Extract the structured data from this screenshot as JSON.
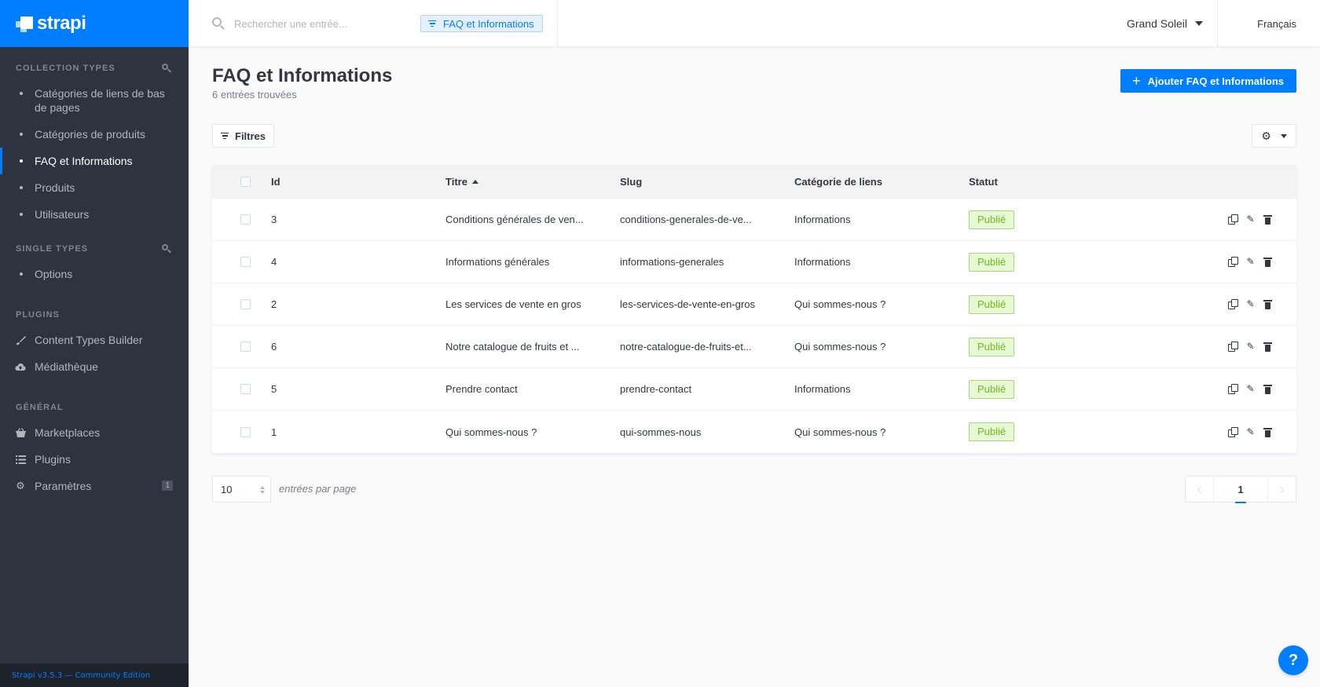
{
  "brand": {
    "name": "strapi"
  },
  "sidebar": {
    "sections": [
      {
        "title": "COLLECTION TYPES",
        "items": [
          {
            "label": "Catégories de liens de bas de pages"
          },
          {
            "label": "Catégories de produits"
          },
          {
            "label": "FAQ et Informations"
          },
          {
            "label": "Produits"
          },
          {
            "label": "Utilisateurs"
          }
        ]
      },
      {
        "title": "SINGLE TYPES",
        "items": [
          {
            "label": "Options"
          }
        ]
      },
      {
        "title": "PLUGINS",
        "items": [
          {
            "label": "Content Types Builder",
            "icon": "paint-brush-icon"
          },
          {
            "label": "Médiathèque",
            "icon": "cloud-upload-icon"
          }
        ]
      },
      {
        "title": "GÉNÉRAL",
        "items": [
          {
            "label": "Marketplaces",
            "icon": "basket-icon"
          },
          {
            "label": "Plugins",
            "icon": "list-icon"
          },
          {
            "label": "Paramètres",
            "icon": "gear-icon",
            "badge": "1"
          }
        ]
      }
    ],
    "footer": "Strapi v3.5.3 — Community Edition"
  },
  "header": {
    "search_placeholder": "Rechercher une entrée...",
    "filter_tag": "FAQ et Informations",
    "user": "Grand Soleil",
    "language": "Français"
  },
  "main": {
    "title": "FAQ et Informations",
    "subtitle": "6 entrées trouvées",
    "add_button": "Ajouter FAQ et Informations",
    "filters_button": "Filtres",
    "table": {
      "columns": [
        "Id",
        "Titre",
        "Slug",
        "Catégorie de liens",
        "Statut"
      ],
      "rows": [
        {
          "id": "3",
          "title": "Conditions générales de ven...",
          "slug": "conditions-generales-de-ve...",
          "category": "Informations",
          "status": "Publié"
        },
        {
          "id": "4",
          "title": "Informations générales",
          "slug": "informations-generales",
          "category": "Informations",
          "status": "Publié"
        },
        {
          "id": "2",
          "title": "Les services de vente en gros",
          "slug": "les-services-de-vente-en-gros",
          "category": "Qui sommes-nous ?",
          "status": "Publié"
        },
        {
          "id": "6",
          "title": "Notre catalogue de fruits et ...",
          "slug": "notre-catalogue-de-fruits-et...",
          "category": "Qui sommes-nous ?",
          "status": "Publié"
        },
        {
          "id": "5",
          "title": "Prendre contact",
          "slug": "prendre-contact",
          "category": "Informations",
          "status": "Publié"
        },
        {
          "id": "1",
          "title": "Qui sommes-nous ?",
          "slug": "qui-sommes-nous",
          "category": "Qui sommes-nous ?",
          "status": "Publié"
        }
      ]
    },
    "pagination": {
      "per_page": "10",
      "per_page_label": "entrées par page",
      "current_page": "1"
    }
  },
  "help": "?",
  "colors": {
    "accent": "#007eff",
    "sidebar_bg": "#2e3340",
    "published_bg": "#e6f8d4",
    "published_text": "#6dbb1a"
  }
}
